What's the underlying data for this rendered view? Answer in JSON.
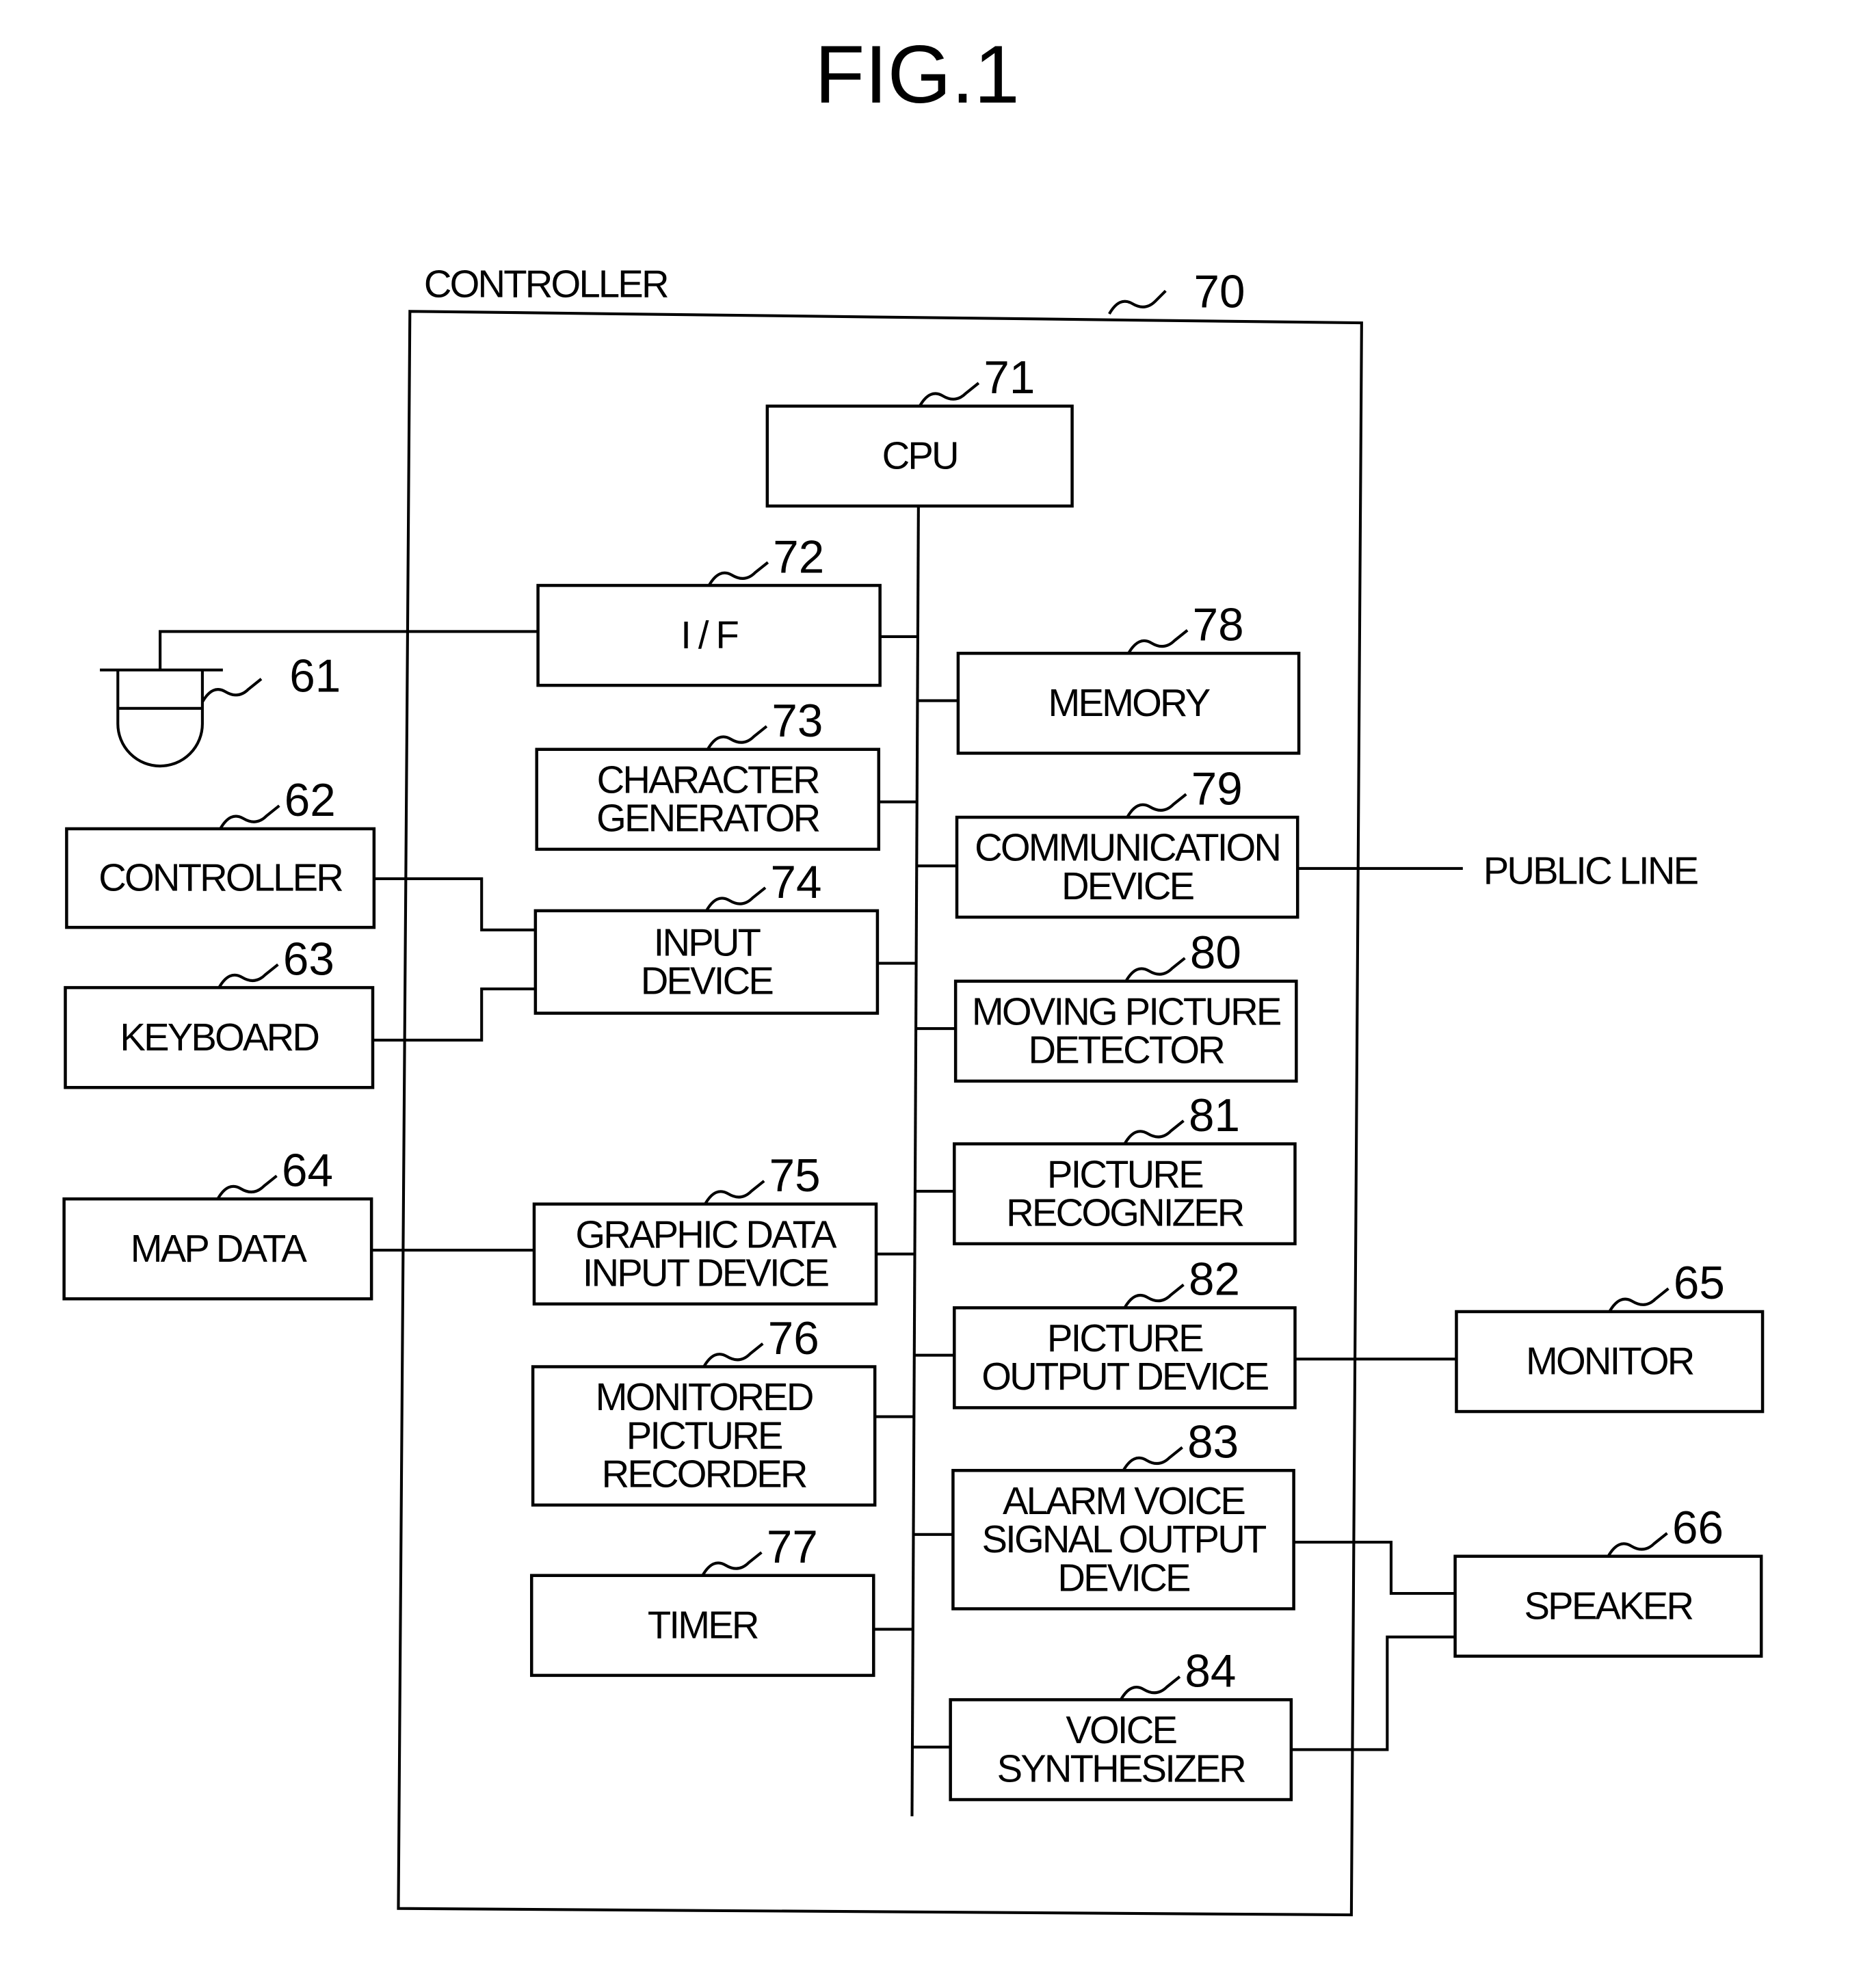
{
  "figure": {
    "title": "FIG.1",
    "controller_label": "CONTROLLER",
    "controller_ref": "70",
    "public_line": "PUBLIC LINE"
  },
  "blocks": {
    "cpu": {
      "ref": "71",
      "lines": [
        "CPU"
      ]
    },
    "if": {
      "ref": "72",
      "lines": [
        "I / F"
      ]
    },
    "char_gen": {
      "ref": "73",
      "lines": [
        "CHARACTER",
        "GENERATOR"
      ]
    },
    "input_device": {
      "ref": "74",
      "lines": [
        "INPUT",
        "DEVICE"
      ]
    },
    "graphic_input": {
      "ref": "75",
      "lines": [
        "GRAPHIC DATA",
        "INPUT DEVICE"
      ]
    },
    "recorder": {
      "ref": "76",
      "lines": [
        "MONITORED",
        "PICTURE",
        "RECORDER"
      ]
    },
    "timer": {
      "ref": "77",
      "lines": [
        "TIMER"
      ]
    },
    "memory": {
      "ref": "78",
      "lines": [
        "MEMORY"
      ]
    },
    "comm": {
      "ref": "79",
      "lines": [
        "COMMUNICATION",
        "DEVICE"
      ]
    },
    "moving": {
      "ref": "80",
      "lines": [
        "MOVING PICTURE",
        "DETECTOR"
      ]
    },
    "recognizer": {
      "ref": "81",
      "lines": [
        "PICTURE",
        "RECOGNIZER"
      ]
    },
    "pic_out": {
      "ref": "82",
      "lines": [
        "PICTURE",
        "OUTPUT DEVICE"
      ]
    },
    "alarm": {
      "ref": "83",
      "lines": [
        "ALARM VOICE",
        "SIGNAL OUTPUT",
        "DEVICE"
      ]
    },
    "synth": {
      "ref": "84",
      "lines": [
        "VOICE",
        "SYNTHESIZER"
      ]
    },
    "ext_controller": {
      "ref": "62",
      "lines": [
        "CONTROLLER"
      ]
    },
    "keyboard": {
      "ref": "63",
      "lines": [
        "KEYBOARD"
      ]
    },
    "map_data": {
      "ref": "64",
      "lines": [
        "MAP DATA"
      ]
    },
    "monitor": {
      "ref": "65",
      "lines": [
        "MONITOR"
      ]
    },
    "speaker": {
      "ref": "66",
      "lines": [
        "SPEAKER"
      ]
    }
  },
  "camera": {
    "ref": "61"
  }
}
